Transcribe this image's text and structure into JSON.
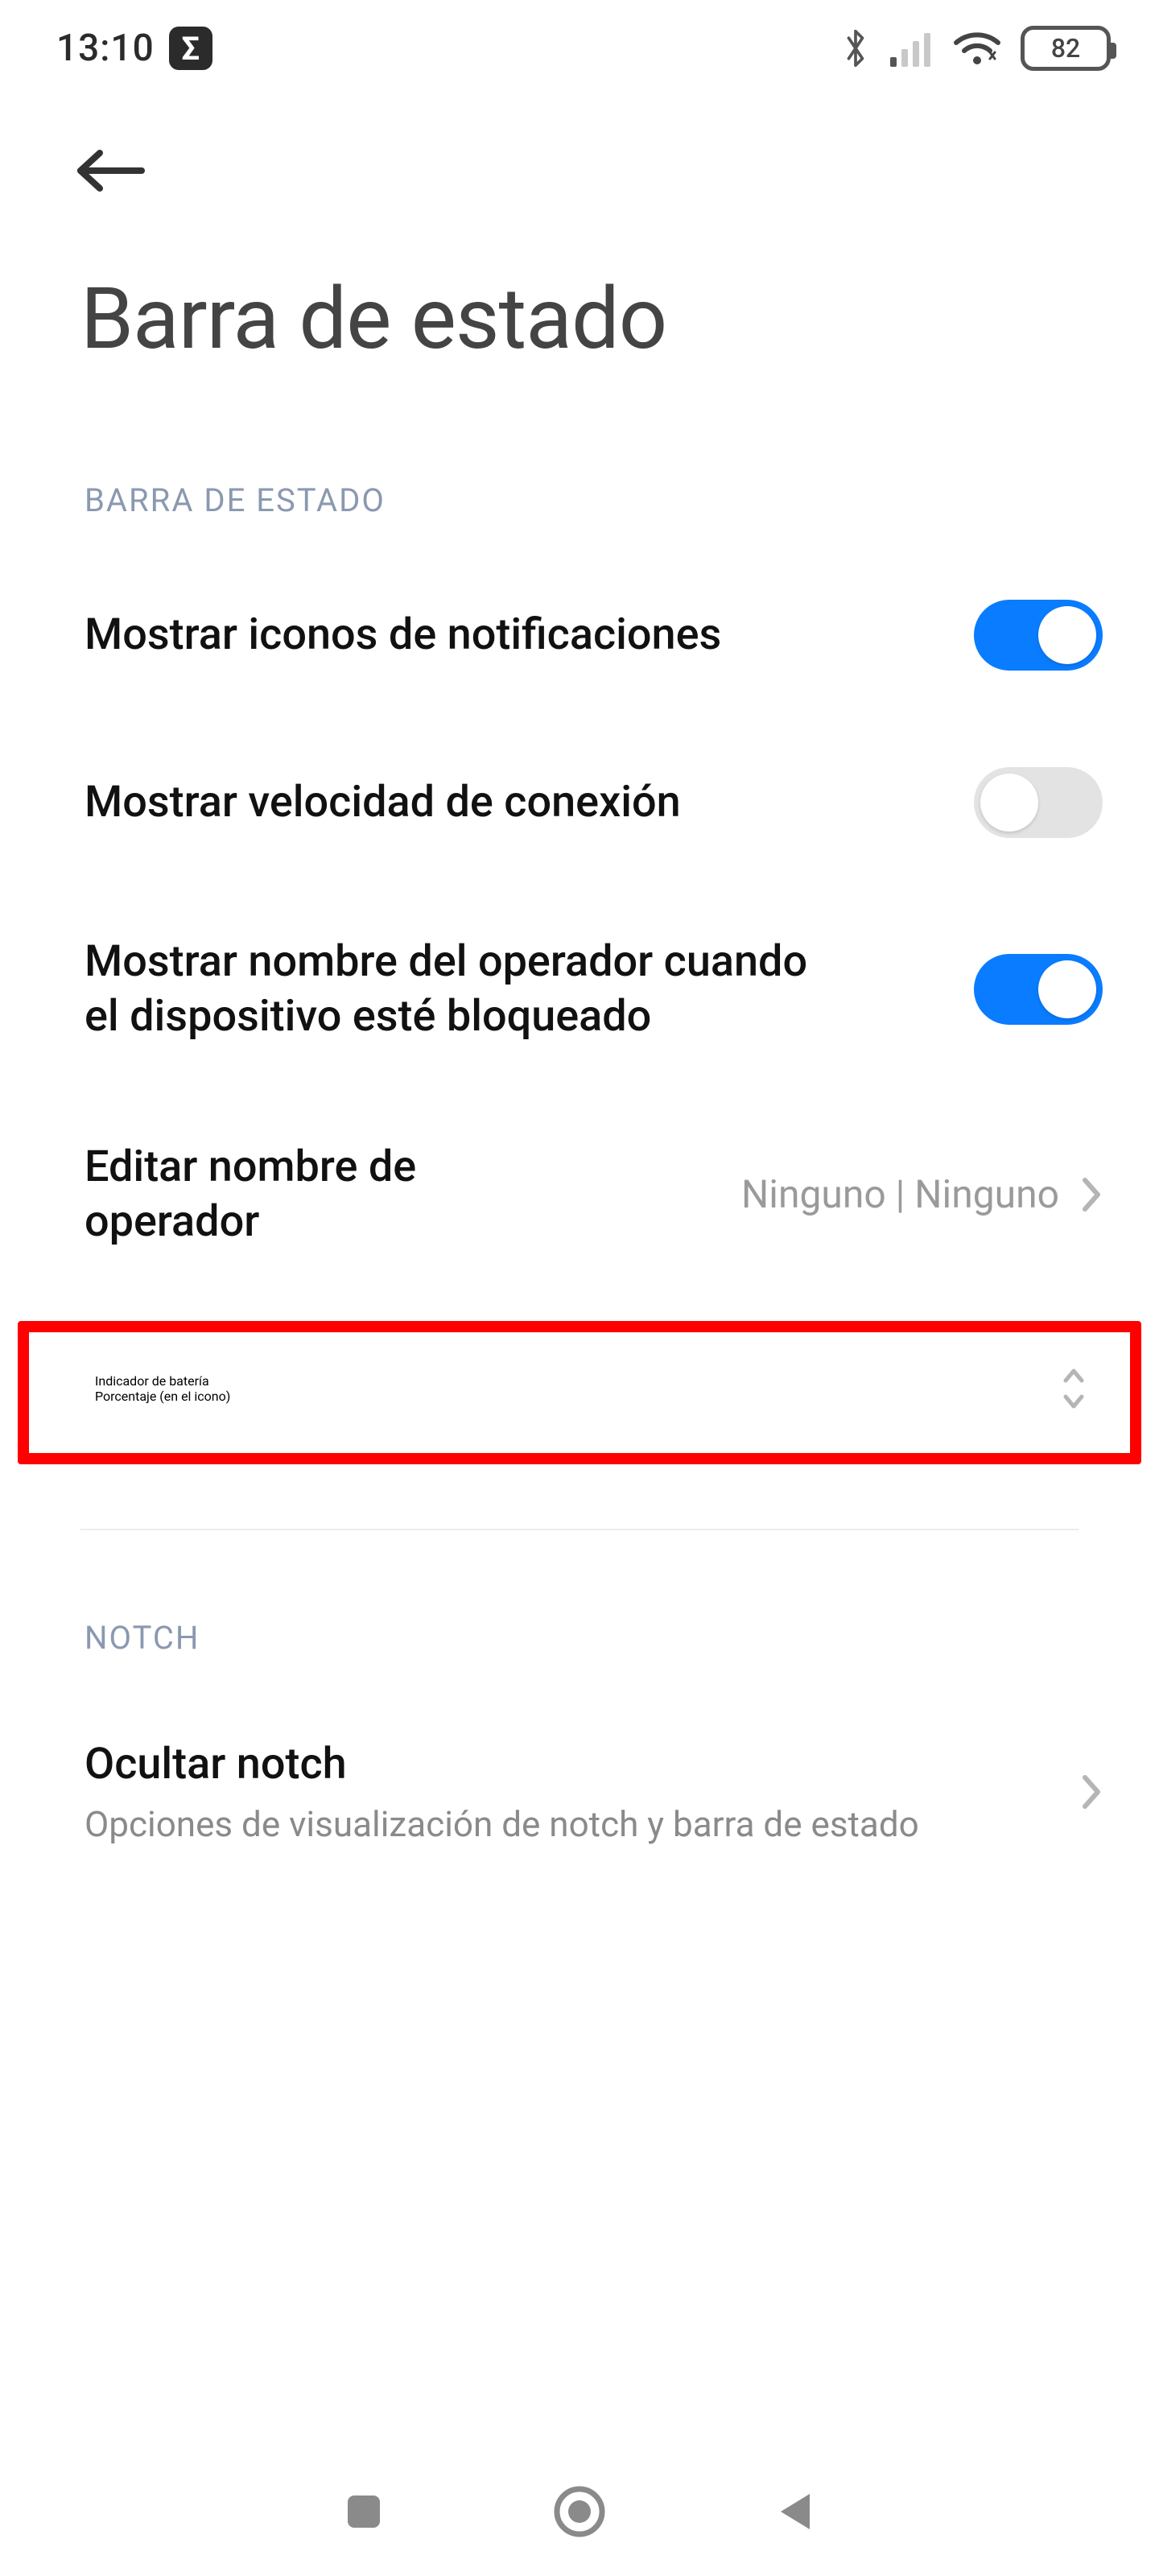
{
  "status": {
    "time": "13:10",
    "sigma_badge": "Σ",
    "battery_percent": "82"
  },
  "header": {
    "title": "Barra de estado"
  },
  "section1": {
    "label": "BARRA DE ESTADO",
    "row_notif_icons": {
      "label": "Mostrar iconos de notificaciones",
      "on": true
    },
    "row_speed": {
      "label": "Mostrar velocidad de conexión",
      "on": false
    },
    "row_operator_lock": {
      "label": "Mostrar nombre del operador cuando el dispositivo esté bloqueado",
      "on": true
    },
    "row_edit_operator": {
      "label": "Editar nombre de operador",
      "value": "Ninguno | Ninguno"
    },
    "row_battery_indicator": {
      "label": "Indicador de batería",
      "sub": "Porcentaje (en el icono)"
    }
  },
  "section2": {
    "label": "NOTCH",
    "row_hide_notch": {
      "label": "Ocultar notch",
      "sub": "Opciones de visualización de notch y barra de estado"
    }
  }
}
